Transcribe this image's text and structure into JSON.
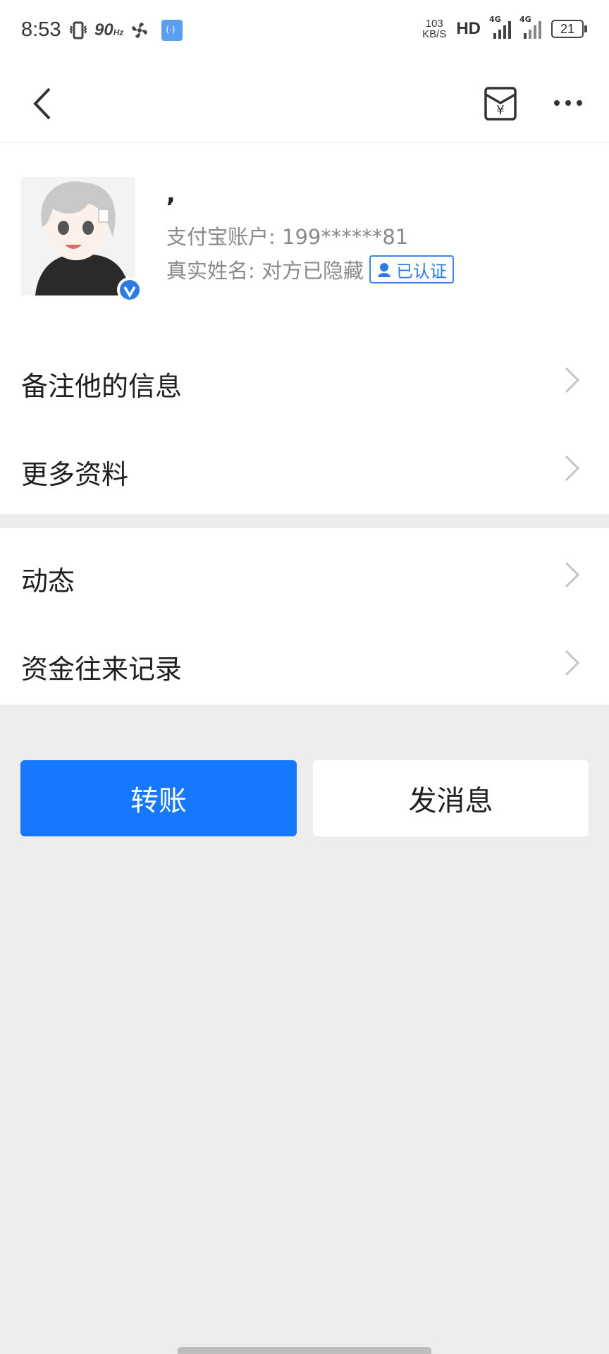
{
  "status_bar": {
    "time": "8:53",
    "refresh_rate": "90",
    "refresh_unit": "Hz",
    "net_speed_value": "103",
    "net_speed_unit": "KB/S",
    "hd_label": "HD",
    "signal_1_label": "4G",
    "signal_2_label": "4G",
    "battery": "21"
  },
  "nav": {
    "back_icon": "chevron-left-icon",
    "envelope_icon": "red-envelope-icon",
    "more_icon": "more-dots-icon"
  },
  "profile": {
    "nickname": ",",
    "account_label": "支付宝账户: 199******81",
    "realname_label": "真实姓名: 对方已隐藏",
    "auth_badge": "已认证",
    "avatar_desc_icon": "avatar-illustration"
  },
  "list_group_1": [
    {
      "label": "备注他的信息"
    },
    {
      "label": "更多资料"
    }
  ],
  "list_group_2": [
    {
      "label": "动态"
    },
    {
      "label": "资金往来记录"
    }
  ],
  "actions": {
    "transfer": "转账",
    "message": "发消息"
  },
  "colors": {
    "primary_blue": "#1677ff",
    "background": "#ededed",
    "secondary_text": "#8a8a8a"
  }
}
